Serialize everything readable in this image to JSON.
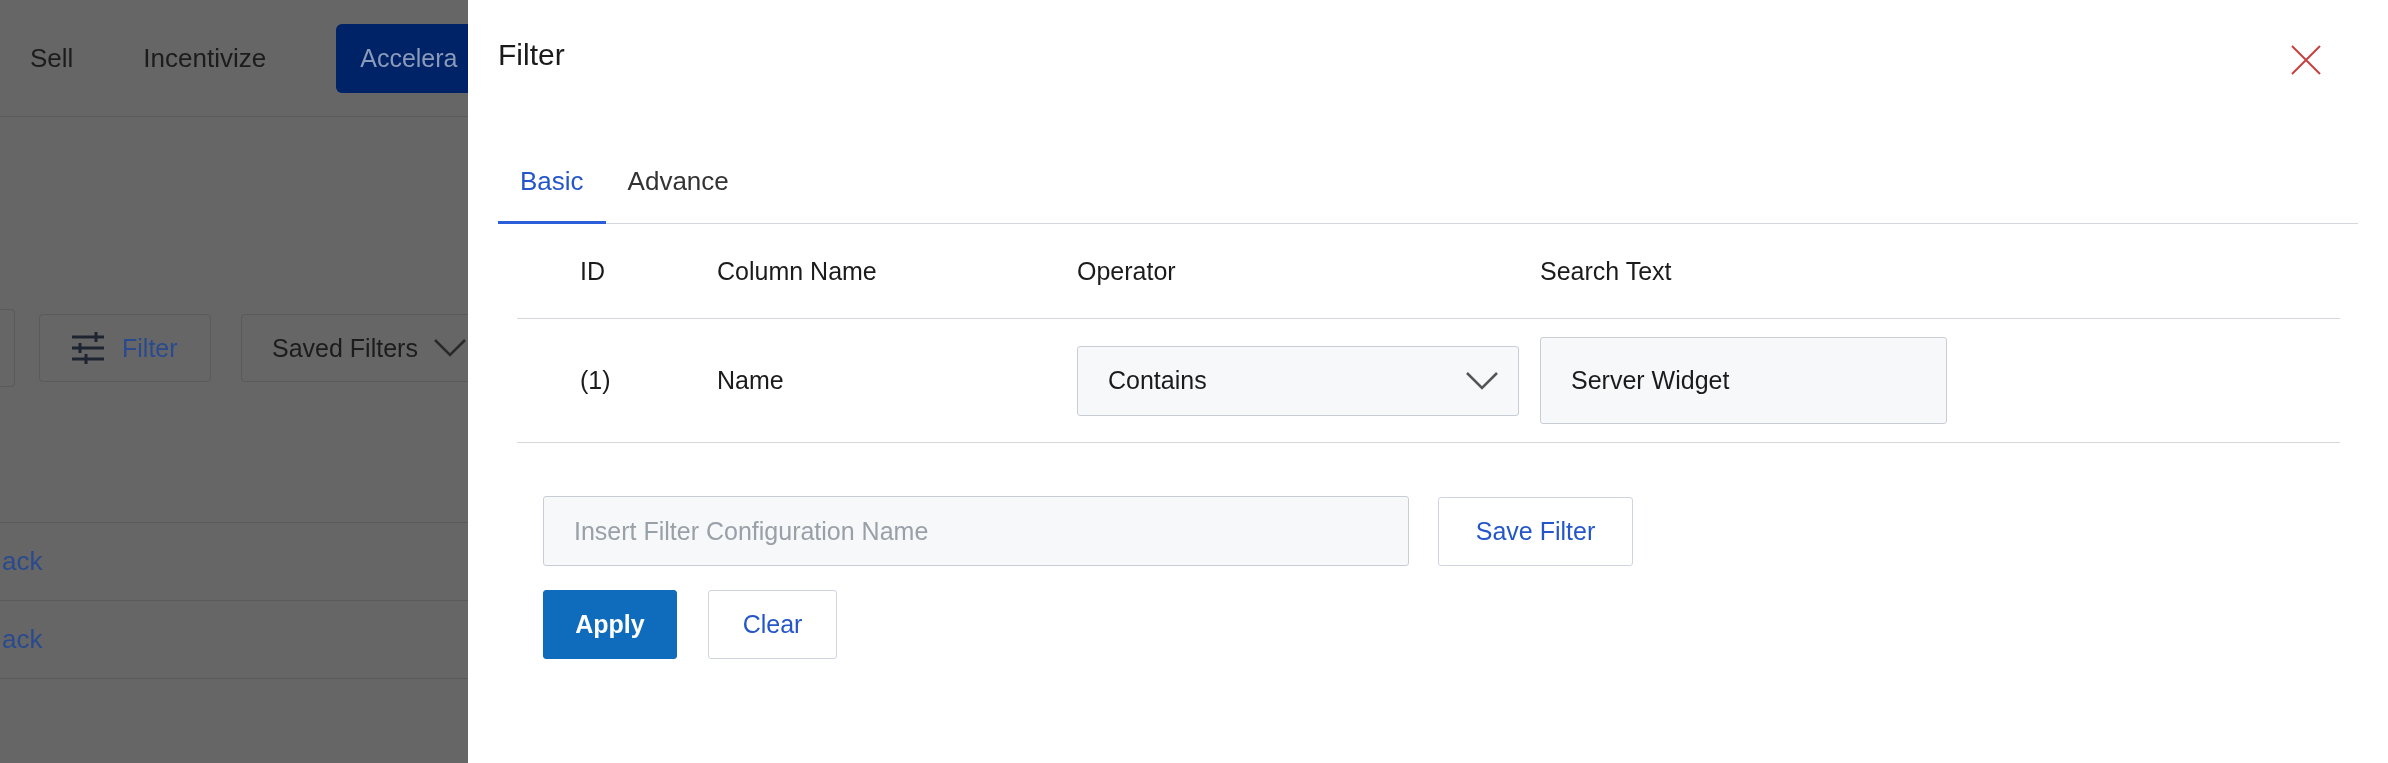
{
  "background": {
    "nav": [
      {
        "label": "Sell",
        "selected": false
      },
      {
        "label": "Incentivize",
        "selected": false
      },
      {
        "label": "Accelera",
        "selected": true
      }
    ],
    "toolbar": {
      "filter_button": "Filter",
      "saved_filters": "Saved Filters"
    },
    "rows": [
      {
        "link": "ack"
      },
      {
        "link": "ack"
      }
    ]
  },
  "panel": {
    "title": "Filter",
    "tabs": [
      {
        "label": "Basic",
        "selected": true
      },
      {
        "label": "Advance",
        "selected": false
      }
    ],
    "columns": [
      "ID",
      "Column Name",
      "Operator",
      "Search Text"
    ],
    "rows": [
      {
        "id": "(1)",
        "column": "Name",
        "operator": "Contains",
        "search_text": "Server Widget"
      }
    ],
    "config_name": {
      "placeholder": "Insert Filter Configuration Name"
    },
    "save_button": "Save Filter",
    "apply_button": "Apply",
    "clear_button": "Clear"
  }
}
